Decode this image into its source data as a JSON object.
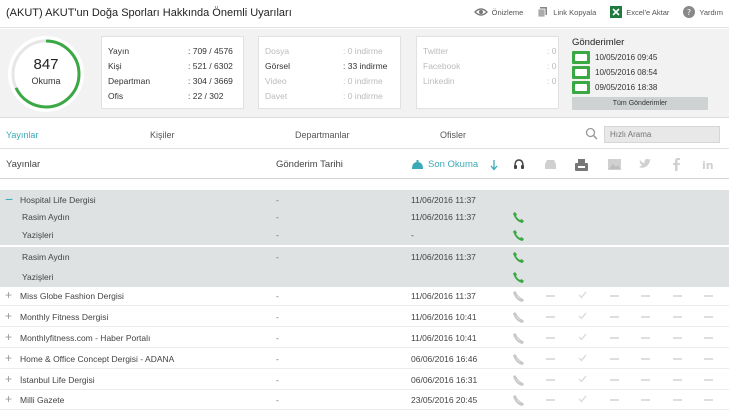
{
  "header": {
    "title": "(AKUT) AKUT'un Doğa Sporları Hakkında Önemli Uyarıları",
    "actions": [
      {
        "label": "Önizleme",
        "icon": "eye-icon"
      },
      {
        "label": "Link Kopyala",
        "icon": "copy-icon"
      },
      {
        "label": "Excel'e Aktar",
        "icon": "excel-icon"
      },
      {
        "label": "Yardım",
        "icon": "help-icon"
      }
    ]
  },
  "stats": {
    "reads": {
      "value": "847",
      "label": "Okuma",
      "progress": 0.68
    },
    "reach": [
      {
        "label": "Yayın",
        "value": ": 709 / 4576"
      },
      {
        "label": "Kişi",
        "value": ": 521 / 6302"
      },
      {
        "label": "Departman",
        "value": ": 304 / 3669"
      },
      {
        "label": "Ofis",
        "value": ": 22 / 302"
      }
    ],
    "downloads": [
      {
        "label": "Dosya",
        "value": ": 0 indirme"
      },
      {
        "label": "Görsel",
        "value": ": 33 indirme"
      },
      {
        "label": "Video",
        "value": ": 0 indirme"
      },
      {
        "label": "Davet",
        "value": ": 0 indirme"
      }
    ],
    "social": [
      {
        "label": "Twitter",
        "value": ": 0"
      },
      {
        "label": "Facebook",
        "value": ": 0"
      },
      {
        "label": "Linkedin",
        "value": ": 0"
      }
    ],
    "sends": {
      "title": "Gönderimler",
      "items": [
        "10/05/2016 09:45",
        "10/05/2016 08:54",
        "09/05/2016 18:38"
      ],
      "all_button": "Tüm Gönderimler"
    }
  },
  "tabs": [
    "Yayınlar",
    "Kişiler",
    "Departmanlar",
    "Ofisler"
  ],
  "search": {
    "placeholder": "Hızlı Arama"
  },
  "table": {
    "columns": {
      "name": "Yayınlar",
      "sent": "Gönderim Tarihi",
      "last_read": "Son Okuma"
    },
    "rows": [
      {
        "name": "Hospital Life Dergisi",
        "sent": "-",
        "last_read": "11/06/2016 11:37"
      },
      {
        "name": "Rasim Aydın",
        "sent": "-",
        "last_read": "11/06/2016 11:37"
      },
      {
        "name": "Yazişleri",
        "sent": "-",
        "last_read": "-"
      },
      {
        "name": "Rasim Aydın",
        "sent": "-",
        "last_read": "11/06/2016 11:37"
      },
      {
        "name": "Yazişleri",
        "sent": "-",
        "last_read": "-"
      },
      {
        "name": "Miss Globe Fashion Dergisi",
        "sent": "-",
        "last_read": "11/06/2016 11:37"
      },
      {
        "name": "Monthly Fitness Dergisi",
        "sent": "-",
        "last_read": "11/06/2016 10:41"
      },
      {
        "name": "Monthlyfitness.com - Haber Portalı",
        "sent": "-",
        "last_read": "11/06/2016 10:41"
      },
      {
        "name": "Home & Office Concept Dergisi - ADANA",
        "sent": "-",
        "last_read": "06/06/2016 16:46"
      },
      {
        "name": "İstanbul Life Dergisi",
        "sent": "-",
        "last_read": "06/06/2016 16:31"
      },
      {
        "name": "Milli Gazete",
        "sent": "-",
        "last_read": "23/05/2016 20:45"
      }
    ]
  },
  "colors": {
    "accent": "#3aaab7",
    "green": "#3aa843",
    "panel": "#f2f2f2"
  }
}
